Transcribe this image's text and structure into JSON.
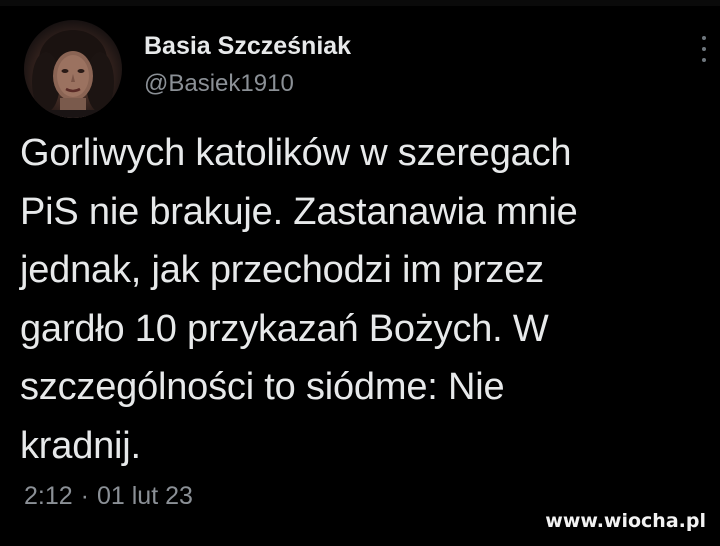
{
  "author": {
    "display_name": "Basia Szcześniak",
    "handle": "@Basiek1910"
  },
  "tweet": {
    "lines": [
      "Gorliwych katolików w szeregach",
      "PiS nie brakuje. Zastanawia mnie",
      "jednak, jak przechodzi im przez",
      "gardło 10 przykazań Bożych. W",
      "szczególności to siódme: Nie",
      "kradnij."
    ],
    "time": "2:12",
    "separator": "·",
    "date": "01 lut 23"
  },
  "watermark": {
    "text": "www.wiocha.pl"
  },
  "icons": {
    "avatar": "profile-photo",
    "more": "more-options-icon"
  },
  "colors": {
    "background": "#000000",
    "primary_text": "#e7e9ea",
    "secondary_text": "#8b9096"
  }
}
